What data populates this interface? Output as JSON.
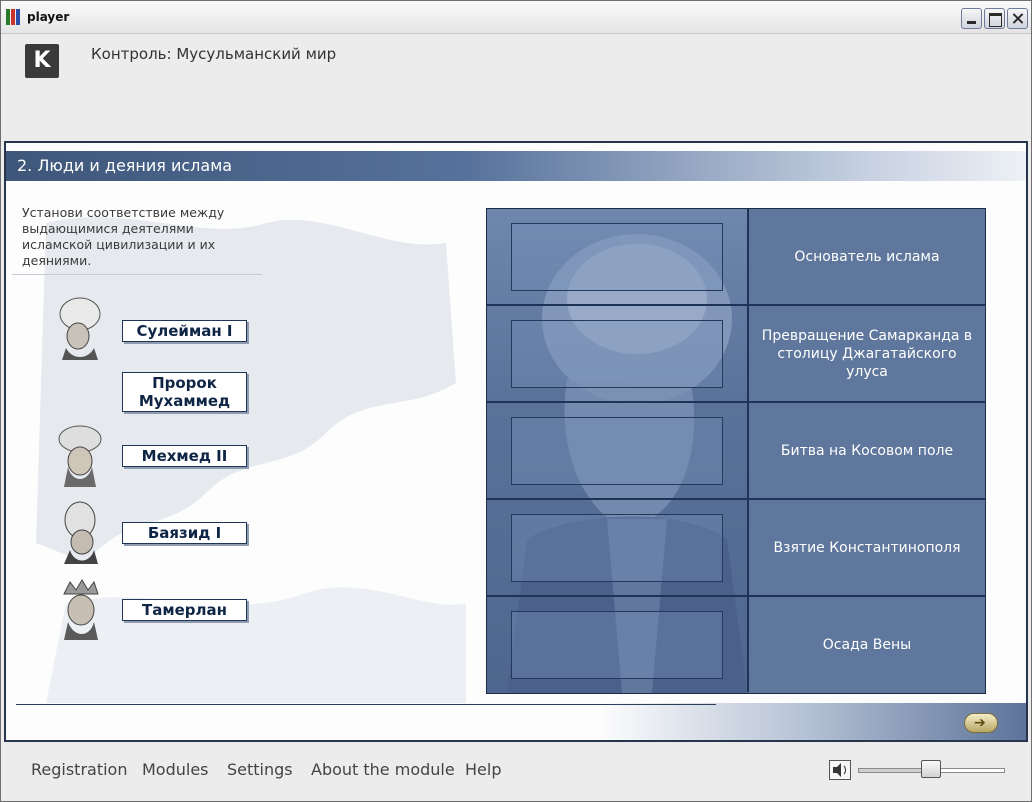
{
  "window": {
    "title": "player"
  },
  "header": {
    "course_title": "Контроль: Мусульманский мир",
    "logo_text": "K"
  },
  "section": {
    "title": "2. Люди и деяния ислама"
  },
  "instructions": "Установи соответствие между выдающимися деятелями исламской цивилизации и их деяниями.",
  "people": [
    {
      "name": "Сулейман I",
      "portrait": true
    },
    {
      "name": "Пророк Мухаммед",
      "portrait": false
    },
    {
      "name": "Мехмед II",
      "portrait": true
    },
    {
      "name": "Баязид I",
      "portrait": true
    },
    {
      "name": "Тамерлан",
      "portrait": true
    }
  ],
  "deeds": [
    "Основатель ислама",
    "Превращение Самарканда в столицу Джагатайского улуса",
    "Битва на Косовом поле",
    "Взятие Константинополя",
    "Осада Вены"
  ],
  "menu": [
    {
      "label": "Registration"
    },
    {
      "label": "Modules"
    },
    {
      "label": "Settings"
    },
    {
      "label": "About the module"
    },
    {
      "label": "Help"
    }
  ],
  "volume": {
    "level": 0.5
  },
  "colors": {
    "accent": "#3e5679",
    "board": "#5f779c",
    "card_text": "#0f2545"
  }
}
